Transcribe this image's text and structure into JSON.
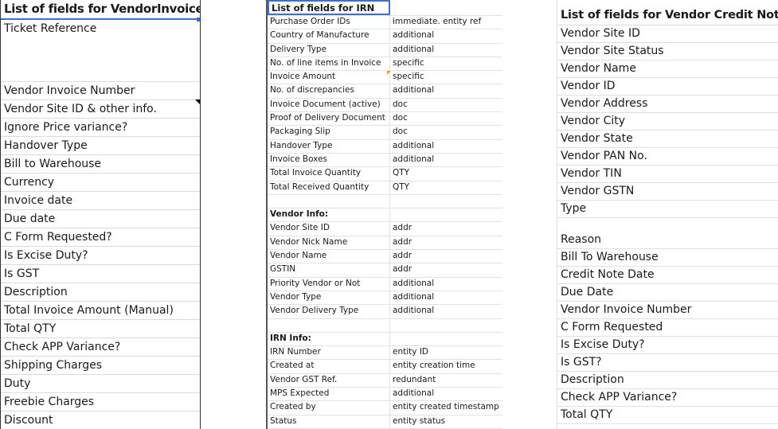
{
  "vendor_invoice": {
    "title": "List of fields for VendorInvoice",
    "fields": [
      "Ticket Reference",
      "Vendor Invoice Number",
      "Vendor Site ID & other info.",
      "Ignore Price variance?",
      "Handover Type",
      "Bill to Warehouse",
      "Currency",
      "Invoice date",
      "Due date",
      "C Form Requested?",
      "Is Excise Duty?",
      "Is GST",
      "Description",
      "Total Invoice Amount (Manual)",
      "Total QTY",
      "Check APP Variance?",
      "Shipping Charges",
      "Duty",
      "Freebie Charges",
      "Discount"
    ]
  },
  "irn": {
    "title": "List of fields for IRN",
    "rows": [
      [
        "Purchase Order IDs",
        "immediate. entity ref"
      ],
      [
        "Country of Manufacture",
        "additional"
      ],
      [
        "Delivery Type",
        "additional"
      ],
      [
        "No. of line items in Invoice",
        "specific"
      ],
      [
        "Invoice Amount",
        "specific"
      ],
      [
        "No. of discrepancies",
        "additional"
      ],
      [
        "Invoice Document (active)",
        "doc"
      ],
      [
        "Proof of Delivery Document",
        "doc"
      ],
      [
        "Packaging Slip",
        "doc"
      ],
      [
        "Handover Type",
        "additional"
      ],
      [
        "Invoice Boxes",
        "additional"
      ],
      [
        "Total Invoice Quantity",
        "QTY"
      ],
      [
        "Total Received Quantity",
        "QTY"
      ],
      [
        "",
        ""
      ],
      [
        "Vendor Info:",
        ""
      ],
      [
        "Vendor Site ID",
        "addr"
      ],
      [
        "Vendor Nick Name",
        "addr"
      ],
      [
        "Vendor Name",
        "addr"
      ],
      [
        "GSTIN",
        "addr"
      ],
      [
        "Priority Vendor or Not",
        "additional"
      ],
      [
        "Vendor Type",
        "additional"
      ],
      [
        "Vendor Delivery Type",
        "additional"
      ],
      [
        "",
        ""
      ],
      [
        "IRN Info:",
        ""
      ],
      [
        "IRN Number",
        "entity ID"
      ],
      [
        "Created at",
        "entity creation time"
      ],
      [
        "Vendor GST Ref.",
        "redundant"
      ],
      [
        "MPS Expected",
        "additional"
      ],
      [
        "Created by",
        "entity created timestamp"
      ],
      [
        "Status",
        "entity status"
      ]
    ]
  },
  "credit_note": {
    "title": "List of fields for Vendor Credit Note",
    "fields": [
      "Vendor Site ID",
      "Vendor Site Status",
      "Vendor Name",
      "Vendor ID",
      "Vendor Address",
      "Vendor City",
      "Vendor State",
      "Vendor PAN No.",
      "Vendor TIN",
      "Vendor GSTN",
      "Type",
      "Reason",
      "Bill To Warehouse",
      "Credit Note Date",
      "Due Date",
      "Vendor Invoice Number",
      "C Form Requested",
      "Is Excise Duty?",
      "Is GST?",
      "Description",
      "Check APP Variance?",
      "Total QTY",
      ""
    ]
  },
  "colors": {
    "selection": "#3b6fd8",
    "comment_marker": "#f0a020"
  }
}
